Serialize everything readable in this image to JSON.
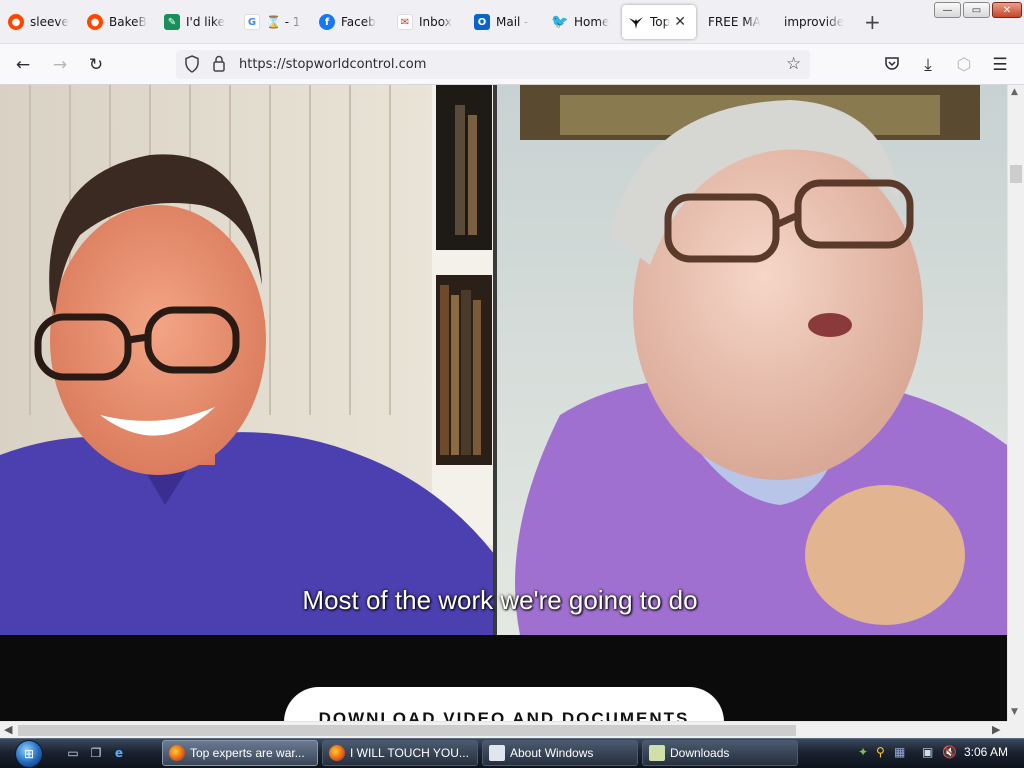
{
  "browser": {
    "tabs": [
      {
        "label": "sleeve",
        "icon": "reddit-icon",
        "color": "#ff4500"
      },
      {
        "label": "BakeB",
        "icon": "reddit-icon",
        "color": "#ff4500"
      },
      {
        "label": "I'd like",
        "icon": "chat-bubble-icon",
        "color": "#1a8f5a"
      },
      {
        "label": "⌛ - 1",
        "icon": "google-icon",
        "color": "#4285f4"
      },
      {
        "label": "Faceb",
        "icon": "facebook-icon",
        "color": "#1877f2"
      },
      {
        "label": "Inbox",
        "icon": "mail-icon",
        "color": "#c0392b"
      },
      {
        "label": "Mail -",
        "icon": "outlook-icon",
        "color": "#0a64c8"
      },
      {
        "label": "Home",
        "icon": "twitter-icon",
        "color": "#1da1f2"
      },
      {
        "label": "Top",
        "icon": "eagle-icon",
        "color": "#111111",
        "active": true
      },
      {
        "label": "FREE MA",
        "icon": "",
        "color": ""
      },
      {
        "label": "improvide",
        "icon": "",
        "color": ""
      }
    ],
    "new_tab_symbol": "+",
    "url": "https://stopworldcontrol.com",
    "window_controls": {
      "minimize": "—",
      "restore": "▭",
      "close": "✕"
    }
  },
  "page": {
    "video_subtitle": "Most of the work we're going to do",
    "download_button": "DOWNLOAD VIDEO AND DOCUMENTS"
  },
  "taskbar": {
    "buttons": [
      {
        "label": "Top experts are war...",
        "icon": "firefox-icon",
        "active": true
      },
      {
        "label": "I WILL TOUCH YOU...",
        "icon": "firefox-icon",
        "active": false
      },
      {
        "label": "About Windows",
        "icon": "window-icon",
        "active": false
      },
      {
        "label": "Downloads",
        "icon": "folder-icon",
        "active": false
      }
    ],
    "clock": "3:06 AM"
  }
}
